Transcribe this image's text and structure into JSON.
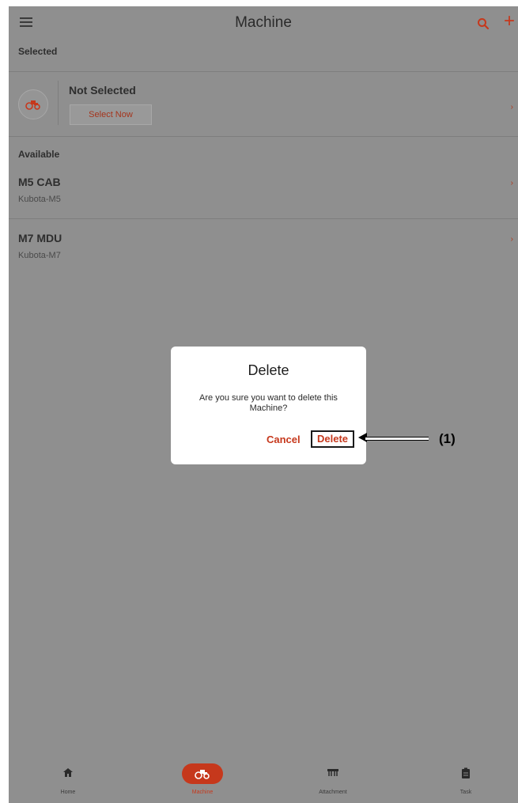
{
  "header": {
    "title": "Machine"
  },
  "sections": {
    "selected_label": "Selected",
    "available_label": "Available"
  },
  "selected_card": {
    "status": "Not Selected",
    "select_button": "Select Now"
  },
  "machines": [
    {
      "name": "M5 CAB",
      "model": "Kubota-M5"
    },
    {
      "name": "M7 MDU",
      "model": "Kubota-M7"
    }
  ],
  "dialog": {
    "title": "Delete",
    "message": "Are you sure you want to delete this Machine?",
    "cancel_label": "Cancel",
    "delete_label": "Delete"
  },
  "callout": {
    "label": "(1)"
  },
  "nav": {
    "items": [
      {
        "label": "Home",
        "icon": "home-icon"
      },
      {
        "label": "Machine",
        "icon": "tractor-icon",
        "active": true
      },
      {
        "label": "Attachment",
        "icon": "implement-icon"
      },
      {
        "label": "Task",
        "icon": "clipboard-icon"
      }
    ]
  },
  "colors": {
    "accent": "#c6381c",
    "overlay_bg": "#8f8f8f",
    "dialog_bg": "#ffffff"
  }
}
